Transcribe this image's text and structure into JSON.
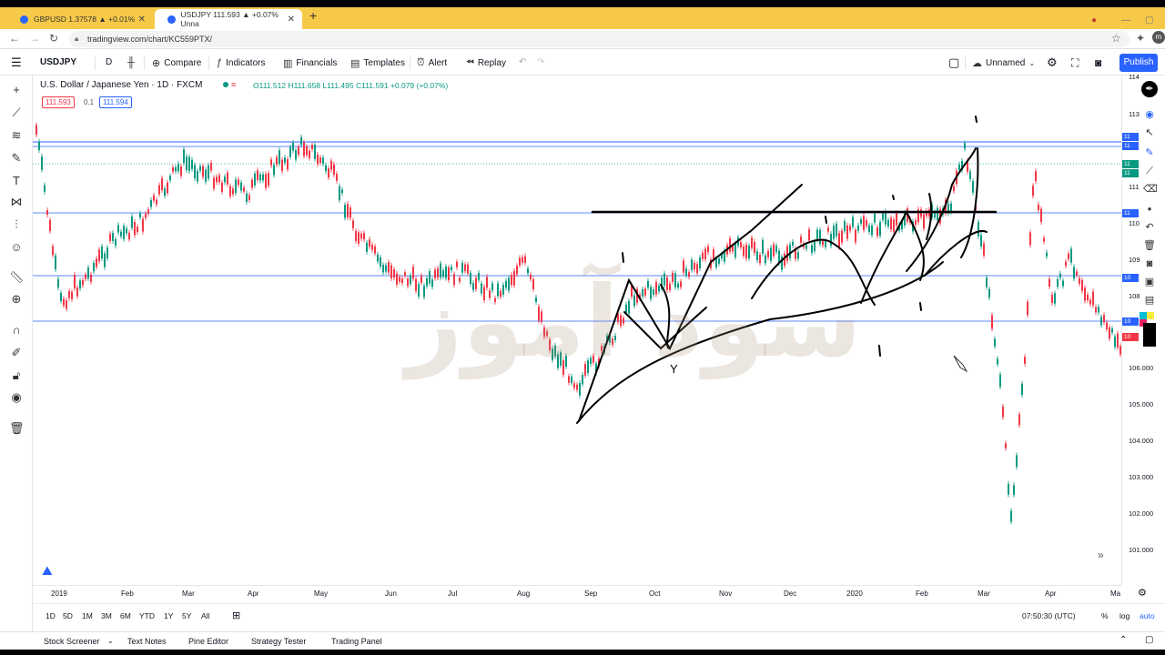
{
  "browser": {
    "tabs": [
      {
        "label": "GBPUSD 1.37578 ▲ +0.01%",
        "active": false
      },
      {
        "label": "USDJPY 111.593 ▲ +0.07% Unna",
        "active": true
      }
    ],
    "new_tab": "+",
    "url": "tradingview.com/chart/KC559PTX/"
  },
  "toolbar": {
    "symbol": "USDJPY",
    "interval": "D",
    "compare": "Compare",
    "indicators": "Indicators",
    "financials": "Financials",
    "templates": "Templates",
    "alert": "Alert",
    "replay": "Replay",
    "layout_name": "Unnamed",
    "publish": "Publish"
  },
  "legend": {
    "title": "U.S. Dollar / Japanese Yen · 1D · FXCM",
    "ohlc": "O111.512 H111.658 L111.495 C111.591 +0.079 (+0.07%)",
    "bid": "111.593",
    "spread": "0.1",
    "ask": "111.594"
  },
  "price_axis": [
    "106.000",
    "105.000",
    "104.000",
    "103.000",
    "102.000",
    "101.000"
  ],
  "price_axis_partial": [
    "114",
    "113",
    "111",
    "110",
    "109",
    "108"
  ],
  "price_tags": [
    "11",
    "11",
    "11",
    "11",
    "11",
    "10",
    "10",
    "10"
  ],
  "time_axis": [
    "2019",
    "Feb",
    "Mar",
    "Apr",
    "May",
    "Jun",
    "Jul",
    "Aug",
    "Sep",
    "Oct",
    "Nov",
    "Dec",
    "2020",
    "Feb",
    "Mar",
    "Apr",
    "Ma"
  ],
  "range_buttons": [
    "1D",
    "5D",
    "1M",
    "3M",
    "6M",
    "YTD",
    "1Y",
    "5Y",
    "All"
  ],
  "clock": "07:50:30 (UTC)",
  "scale_opts": [
    "%",
    "log",
    "auto"
  ],
  "bottom_panel": [
    "Stock Screener",
    "Text Notes",
    "Pine Editor",
    "Strategy Tester",
    "Trading Panel"
  ],
  "annotations": {
    "y_mark": "Y"
  },
  "colors": {
    "accent": "#2962ff",
    "up": "#089981",
    "down": "#f23645",
    "tab_strip": "#f7c948"
  }
}
